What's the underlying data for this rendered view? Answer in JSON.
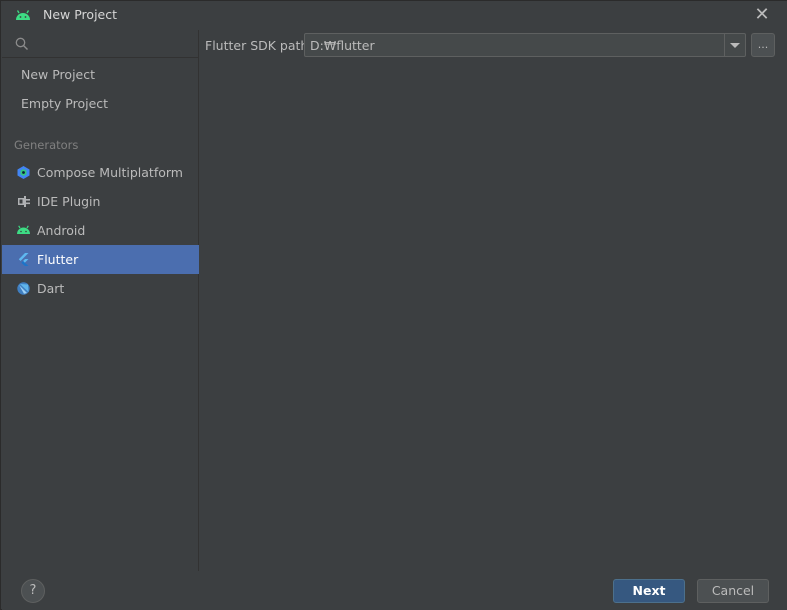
{
  "window": {
    "title": "New Project",
    "title_icon": "android-icon",
    "close_icon": "close-icon"
  },
  "sidebar": {
    "search": {
      "placeholder": "",
      "value": ""
    },
    "top_items": [
      {
        "label": "New Project"
      },
      {
        "label": "Empty Project"
      }
    ],
    "generators_label": "Generators",
    "generator_items": [
      {
        "label": "Compose Multiplatform",
        "icon": "compose-multiplatform-icon",
        "selected": false
      },
      {
        "label": "IDE Plugin",
        "icon": "ide-plugin-icon",
        "selected": false
      },
      {
        "label": "Android",
        "icon": "android-icon",
        "selected": false
      },
      {
        "label": "Flutter",
        "icon": "flutter-icon",
        "selected": true
      },
      {
        "label": "Dart",
        "icon": "dart-icon",
        "selected": false
      }
    ]
  },
  "main": {
    "sdk_path_label": "Flutter SDK path:",
    "sdk_path_value": "D:₩flutter",
    "browse_label": "..."
  },
  "footer": {
    "help_label": "?",
    "next_label": "Next",
    "cancel_label": "Cancel"
  },
  "colors": {
    "background": "#3c3f41",
    "selection": "#4b6eaf",
    "primary_button": "#365880",
    "android_green": "#3ddc84",
    "flutter_blue": "#5fb8f0"
  }
}
